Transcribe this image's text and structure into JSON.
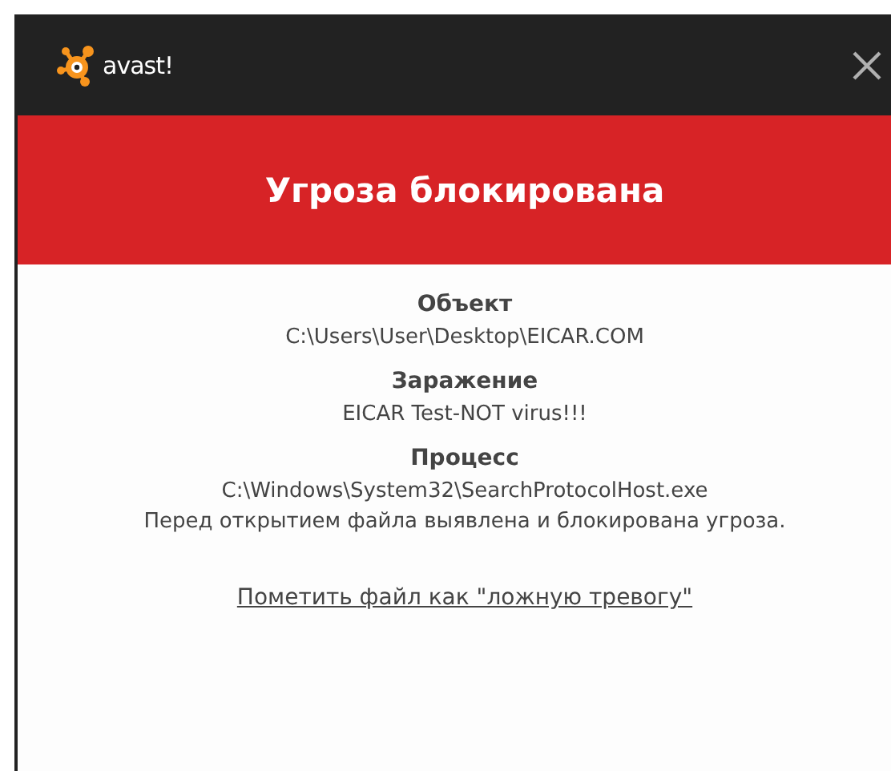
{
  "header": {
    "logo_text": "avast!"
  },
  "banner": {
    "title": "Угроза блокирована"
  },
  "details": [
    {
      "label": "Объект",
      "value": "C:\\Users\\User\\Desktop\\EICAR.COM"
    },
    {
      "label": "Заражение",
      "value": "EICAR Test-NOT virus!!!"
    },
    {
      "label": "Процесс",
      "value": "C:\\Windows\\System32\\SearchProtocolHost.exe"
    }
  ],
  "message": "Перед открытием файла выявлена и блокирована угроза.",
  "link": "Пометить файл как \"ложную тревогу\""
}
